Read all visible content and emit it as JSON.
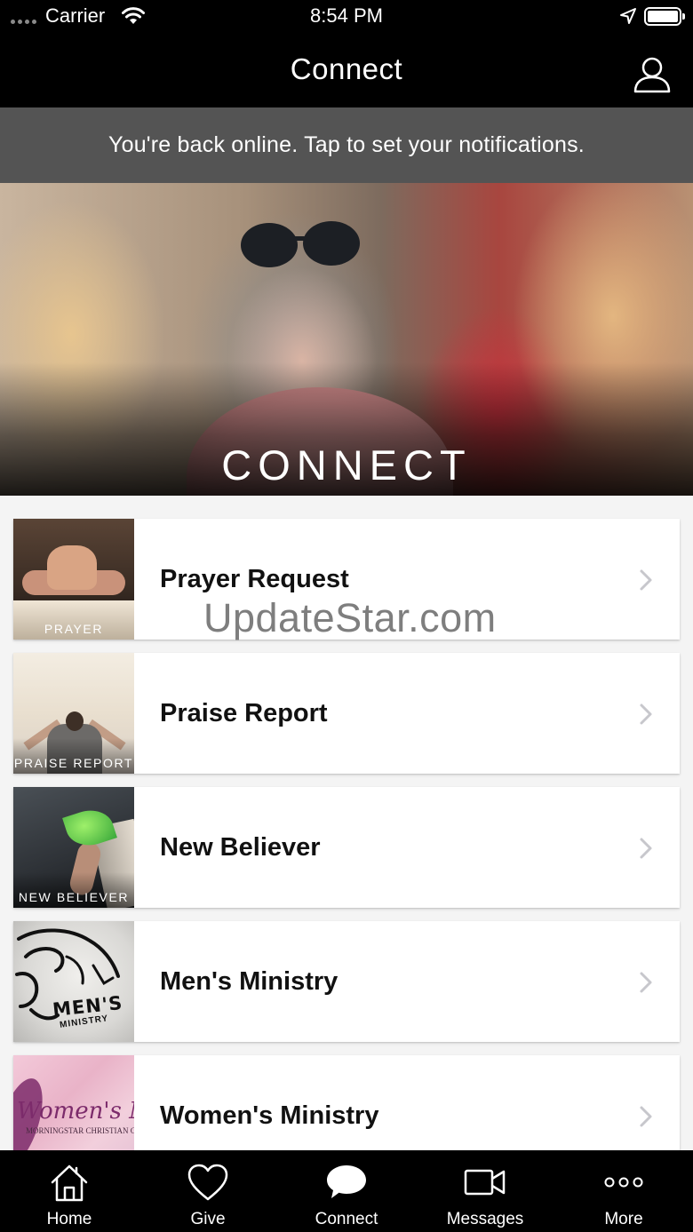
{
  "status_bar": {
    "carrier": "Carrier",
    "time": "8:54 PM"
  },
  "nav": {
    "title": "Connect",
    "profile_icon": "person-icon"
  },
  "banner": {
    "text": "You're back online. Tap to set your notifications."
  },
  "hero": {
    "title": "CONNECT"
  },
  "items": [
    {
      "label": "Prayer Request",
      "thumb_text": "PRAYER"
    },
    {
      "label": "Praise Report",
      "thumb_text": "PRAISE REPORT"
    },
    {
      "label": "New Believer",
      "thumb_text": "NEW BELIEVER"
    },
    {
      "label": "Men's Ministry",
      "thumb_text": "MEN'S",
      "thumb_subtext": "MINISTRY"
    },
    {
      "label": "Women's Ministry",
      "thumb_text": "Women's Min",
      "thumb_subtext": "MORNINGSTAR CHRISTIAN CHA"
    }
  ],
  "watermark": "UpdateStar.com",
  "tabs": [
    {
      "label": "Home",
      "icon": "home-icon"
    },
    {
      "label": "Give",
      "icon": "heart-icon"
    },
    {
      "label": "Connect",
      "icon": "chat-bubble-icon",
      "active": true
    },
    {
      "label": "Messages",
      "icon": "video-camera-icon"
    },
    {
      "label": "More",
      "icon": "more-dots-icon"
    }
  ]
}
